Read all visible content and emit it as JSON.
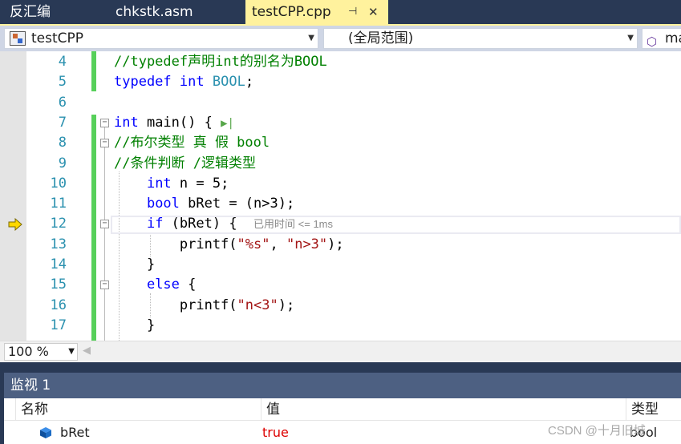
{
  "tabs": [
    {
      "label": "反汇编",
      "active": false
    },
    {
      "label": "chkstk.asm",
      "active": false
    },
    {
      "label": "testCPP.cpp",
      "active": true,
      "pin_icon": "pin-icon",
      "close_glyph": "✕"
    }
  ],
  "nav": {
    "project": "testCPP",
    "scope": "(全局范围)",
    "member": "ma"
  },
  "editor": {
    "lines": [
      {
        "num": "4",
        "tokens": [
          {
            "c": "cmt",
            "t": "//typedef声明int的别名为BOOL"
          }
        ]
      },
      {
        "num": "5",
        "tokens": [
          {
            "c": "kw",
            "t": "typedef"
          },
          {
            "c": "",
            "t": " "
          },
          {
            "c": "kw",
            "t": "int"
          },
          {
            "c": "",
            "t": " "
          },
          {
            "c": "typ",
            "t": "BOOL"
          },
          {
            "c": "",
            "t": ";"
          }
        ]
      },
      {
        "num": "6",
        "tokens": []
      },
      {
        "num": "7",
        "tokens": [
          {
            "c": "kw",
            "t": "int"
          },
          {
            "c": "",
            "t": " main() { "
          },
          {
            "c": "run-to-click",
            "t": "▶|"
          }
        ]
      },
      {
        "num": "8",
        "tokens": [
          {
            "c": "cmt",
            "t": "//布尔类型 真 假 bool"
          }
        ]
      },
      {
        "num": "9",
        "tokens": [
          {
            "c": "cmt",
            "t": "//条件判断 /逻辑类型"
          }
        ]
      },
      {
        "num": "10",
        "tokens": [
          {
            "c": "",
            "t": "    "
          },
          {
            "c": "kw",
            "t": "int"
          },
          {
            "c": "",
            "t": " n = 5;"
          }
        ]
      },
      {
        "num": "11",
        "tokens": [
          {
            "c": "",
            "t": "    "
          },
          {
            "c": "kw",
            "t": "bool"
          },
          {
            "c": "",
            "t": " bRet = (n>3);"
          }
        ]
      },
      {
        "num": "12",
        "tokens": [
          {
            "c": "",
            "t": "    "
          },
          {
            "c": "kw",
            "t": "if"
          },
          {
            "c": "",
            "t": " (bRet) {  "
          },
          {
            "c": "perf-tip",
            "t": "已用时间 <= 1ms"
          }
        ]
      },
      {
        "num": "13",
        "tokens": [
          {
            "c": "",
            "t": "        printf("
          },
          {
            "c": "str",
            "t": "\"%s\""
          },
          {
            "c": "",
            "t": ", "
          },
          {
            "c": "str",
            "t": "\"n>3\""
          },
          {
            "c": "",
            "t": ");"
          }
        ]
      },
      {
        "num": "14",
        "tokens": [
          {
            "c": "",
            "t": "    }"
          }
        ]
      },
      {
        "num": "15",
        "tokens": [
          {
            "c": "",
            "t": "    "
          },
          {
            "c": "kw",
            "t": "else"
          },
          {
            "c": "",
            "t": " {"
          }
        ]
      },
      {
        "num": "16",
        "tokens": [
          {
            "c": "",
            "t": "        printf("
          },
          {
            "c": "str",
            "t": "\"n<3\""
          },
          {
            "c": "",
            "t": ");"
          }
        ]
      },
      {
        "num": "17",
        "tokens": [
          {
            "c": "",
            "t": "    }"
          }
        ]
      }
    ],
    "current_line": "12",
    "colors": {
      "comment": "#008000",
      "keyword": "#0000ff",
      "type": "#2b91af",
      "string": "#a31515",
      "change_bar": "#57d05a"
    }
  },
  "zoom": "100 %",
  "watch": {
    "title": "监视 1",
    "columns": [
      "名称",
      "值",
      "类型"
    ],
    "rows": [
      {
        "name": "bRet",
        "value": "true",
        "type": "bool",
        "icon": "variable-icon"
      }
    ]
  },
  "watermark": "CSDN @十月旧城"
}
